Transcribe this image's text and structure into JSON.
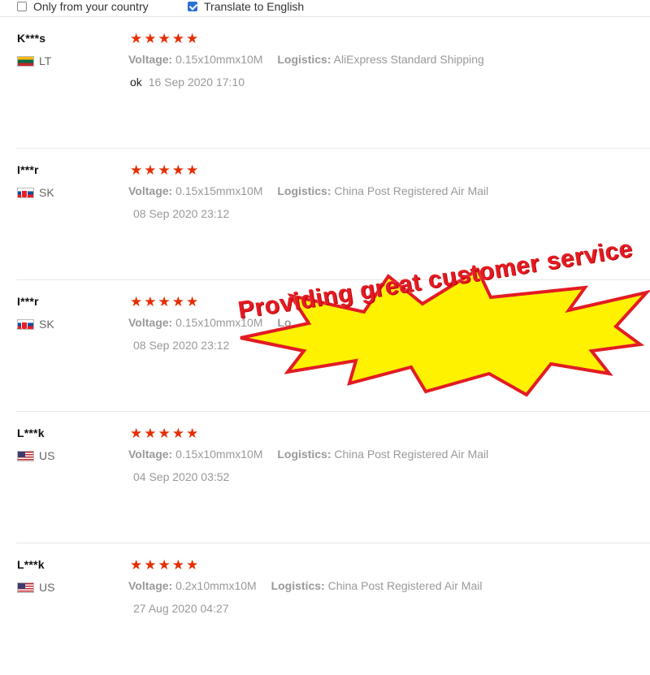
{
  "filters": {
    "only_country_label": "Only from your country",
    "only_country_checked": false,
    "translate_label": "Translate to English",
    "translate_checked": true
  },
  "labels": {
    "voltage": "Voltage:",
    "logistics": "Logistics:"
  },
  "star_icon": "star-icon",
  "star_color": "#e62e04",
  "reviews": [
    {
      "user": "K***s",
      "country": "LT",
      "flag": "lithuania-flag-icon",
      "rating": 5,
      "voltage": "0.15x10mmx10M",
      "logistics": "AliExpress Standard Shipping",
      "feedback": "ok",
      "date": "16 Sep 2020 17:10"
    },
    {
      "user": "I***r",
      "country": "SK",
      "flag": "slovakia-flag-icon",
      "rating": 5,
      "voltage": "0.15x15mmx10M",
      "logistics": "China Post Registered Air Mail",
      "feedback": "",
      "date": "08 Sep 2020 23:12"
    },
    {
      "user": "I***r",
      "country": "SK",
      "flag": "slovakia-flag-icon",
      "rating": 5,
      "voltage": "0.15x10mmx10M",
      "logistics": "Lo",
      "feedback": "",
      "date": "08 Sep 2020 23:12"
    },
    {
      "user": "L***k",
      "country": "US",
      "flag": "usa-flag-icon",
      "rating": 5,
      "voltage": "0.15x10mmx10M",
      "logistics": "China Post Registered Air Mail",
      "feedback": "",
      "date": "04 Sep 2020 03:52"
    },
    {
      "user": "L***k",
      "country": "US",
      "flag": "usa-flag-icon",
      "rating": 5,
      "voltage": "0.2x10mmx10M",
      "logistics": "China Post Registered Air Mail",
      "feedback": "",
      "date": "27 Aug 2020 04:27"
    }
  ],
  "promo": {
    "text": "Providing great customer service",
    "burst_color": "#fff200",
    "burst_stroke": "#e31b23",
    "text_color": "#e31b23"
  }
}
